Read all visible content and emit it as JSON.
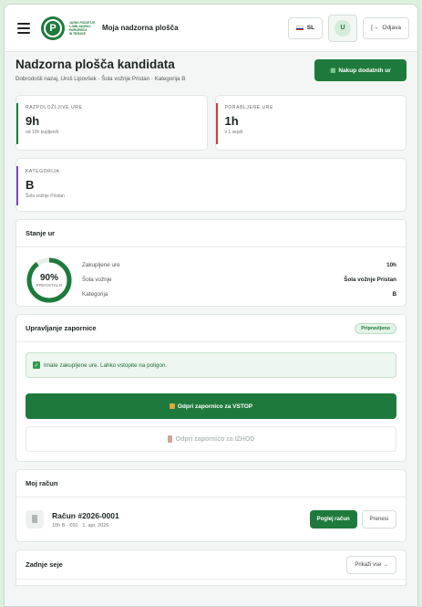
{
  "topbar": {
    "logo_lines": [
      "JAVNO PODJETJE",
      "LJUBLJANSKO",
      "PARKIRIŠČA",
      "IN TRŽNICE"
    ],
    "logo_letter": "P",
    "title": "Moja nadzorna plošča",
    "language": "SL",
    "avatar_initial": "U",
    "logout_label": "Odjava"
  },
  "header": {
    "title": "Nadzorna plošča kandidata",
    "subtitle": "Dobrodošli nazaj, Uroš Lipovšek · Šola vožnje Pristan · Kategorija B",
    "buy_label": "Nakup dodatnih ur"
  },
  "stats": [
    {
      "label": "RAZPOLOŽLJIVE URE",
      "value": "9h",
      "note": "od 10h kupljenih",
      "color": "#1e7a3c"
    },
    {
      "label": "PORABLJENE URE",
      "value": "1h",
      "note": "v 1 sejah",
      "color": "#d9383a"
    }
  ],
  "category_card": {
    "label": "KATEGORIJA",
    "value": "B",
    "note": "Šola vožnje Pristan",
    "color": "#7b48c2"
  },
  "hours_status": {
    "title": "Stanje ur",
    "percent_text": "90%",
    "percent_fraction": 0.9,
    "percent_label": "PREOSTALO",
    "rows": [
      {
        "key": "Zakupljene ure",
        "value": "10h"
      },
      {
        "key": "Šola vožnje",
        "value": "Šola vožnje Pristan"
      },
      {
        "key": "Kategorija",
        "value": "B"
      }
    ]
  },
  "gate": {
    "title": "Upravljanje zapornice",
    "status_badge": "Pripravljeno",
    "alert": "Imate zakupljene ure. Lahko vstopite na poligon.",
    "enter_label": "Odpri zapornico za VSTOP",
    "exit_label": "Odpri zapornico za IZHOD"
  },
  "account": {
    "title": "Moj račun",
    "invoice_title": "Račun #2026-0001",
    "invoice_meta": "10h B · €60 · 1. apr. 2026",
    "view_label": "Poglej račun",
    "download_label": "Prenesi"
  },
  "sessions": {
    "title": "Zadnje seje",
    "show_all_label": "Prikaži vse →"
  },
  "colors": {
    "brand": "#1e7a3c",
    "background": "#dcf0de"
  }
}
